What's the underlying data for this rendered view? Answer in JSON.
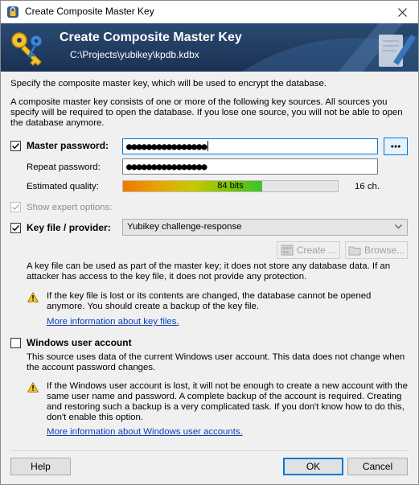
{
  "window": {
    "title": "Create Composite Master Key"
  },
  "banner": {
    "title": "Create Composite Master Key",
    "subtitle": "C:\\Projects\\yubikey\\kpdb.kdbx"
  },
  "intro": {
    "line1": "Specify the composite master key, which will be used to encrypt the database.",
    "paragraph": "A composite master key consists of one or more of the following key sources. All sources you specify will be required to open the database. If you lose one source, you will not be able to open the database anymore."
  },
  "master_password": {
    "checkbox_label": "Master password:",
    "checked": true,
    "value": "●●●●●●●●●●●●●●●●",
    "show_button_label": "●●●",
    "repeat_label": "Repeat password:",
    "repeat_value": "●●●●●●●●●●●●●●●●",
    "quality_label": "Estimated quality:",
    "quality_text": "84 bits",
    "quality_fraction": 0.647,
    "length_text": "16 ch."
  },
  "expert": {
    "label": "Show expert options:",
    "checked": true,
    "disabled": true
  },
  "key_file": {
    "checkbox_label": "Key file / provider:",
    "checked": true,
    "selected": "Yubikey challenge-response",
    "create_label": "Create ...",
    "browse_label": "Browse...",
    "description": "A key file can be used as part of the master key; it does not store any database data. If an attacker has access to the key file, it does not provide any protection.",
    "warning": "If the key file is lost or its contents are changed, the database cannot be opened anymore. You should create a backup of the key file.",
    "more_info": "More information about key files."
  },
  "windows_account": {
    "checkbox_label": "Windows user account",
    "checked": false,
    "description": "This source uses data of the current Windows user account. This data does not change when the account password changes.",
    "warning": "If the Windows user account is lost, it will not be enough to create a new account with the same user name and password. A complete backup of the account is required. Creating and restoring such a backup is a very complicated task. If you don't know how to do this, don't enable this option.",
    "more_info": "More information about Windows user accounts."
  },
  "footer": {
    "help_label": "Help",
    "ok_label": "OK",
    "cancel_label": "Cancel"
  },
  "colors": {
    "banner": "#1f3a60",
    "accent": "#0078d7",
    "link": "#0b3fb7"
  }
}
